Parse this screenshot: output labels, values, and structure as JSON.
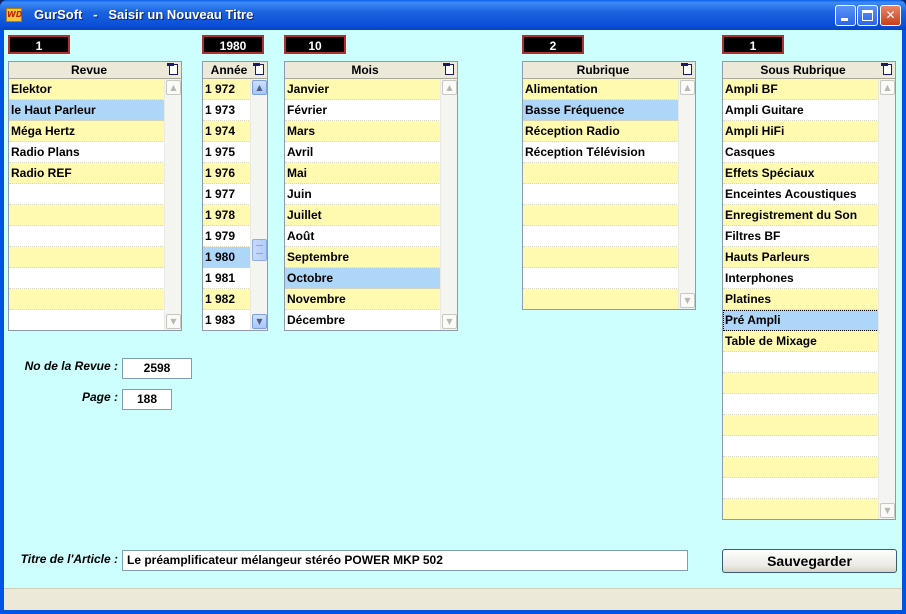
{
  "window": {
    "app_icon_text": "WD",
    "title": "GurSoft   -   Saisir un Nouveau Titre"
  },
  "counters": {
    "revue": "1",
    "annee": "1980",
    "mois": "10",
    "rubrique": "2",
    "sous_rubrique": "1"
  },
  "revue": {
    "header": "Revue",
    "items": [
      "Elektor",
      "le Haut Parleur",
      "Méga Hertz",
      "Radio Plans",
      "Radio REF",
      "",
      "",
      "",
      "",
      "",
      "",
      ""
    ],
    "selected_index": 1
  },
  "annee": {
    "header": "Année",
    "items": [
      "1 972",
      "1 973",
      "1 974",
      "1 975",
      "1 976",
      "1 977",
      "1 978",
      "1 979",
      "1 980",
      "1 981",
      "1 982",
      "1 983"
    ],
    "selected_index": 8
  },
  "mois": {
    "header": "Mois",
    "items": [
      "Janvier",
      "Février",
      "Mars",
      "Avril",
      "Mai",
      "Juin",
      "Juillet",
      "Août",
      "Septembre",
      "Octobre",
      "Novembre",
      "Décembre"
    ],
    "selected_index": 9
  },
  "rubrique": {
    "header": "Rubrique",
    "items": [
      "Alimentation",
      "Basse Fréquence",
      "Réception Radio",
      "Réception Télévision",
      "",
      "",
      "",
      "",
      "",
      "",
      ""
    ],
    "selected_index": 1
  },
  "sous_rubrique": {
    "header": "Sous Rubrique",
    "items": [
      "Ampli BF",
      "Ampli Guitare",
      "Ampli HiFi",
      "Casques",
      "Effets Spéciaux",
      "Enceintes Acoustiques",
      "Enregistrement du Son",
      "Filtres BF",
      "Hauts Parleurs",
      "Interphones",
      "Platines",
      "Pré Ampli",
      "Table de Mixage",
      "",
      "",
      "",
      "",
      "",
      "",
      "",
      ""
    ],
    "selected_index": 11
  },
  "fields": {
    "no_revue_label": "No de la Revue :",
    "no_revue_value": "2598",
    "page_label": "Page :",
    "page_value": "188",
    "titre_label": "Titre de l'Article :",
    "titre_value": "Le préamplificateur mélangeur stéréo POWER MKP 502"
  },
  "buttons": {
    "save": "Sauvegarder",
    "minimize": "",
    "maximize": "",
    "close": "✕"
  }
}
